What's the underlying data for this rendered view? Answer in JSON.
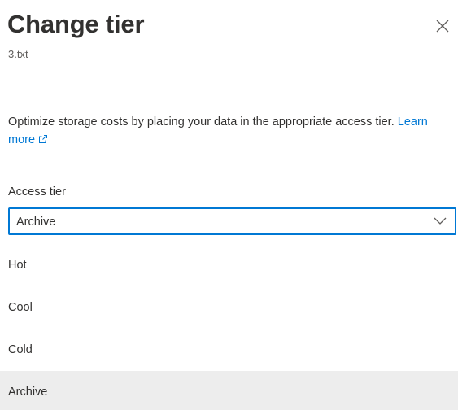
{
  "panel": {
    "title": "Change tier",
    "subtitle": "3.txt",
    "close_icon": "close-icon"
  },
  "description": {
    "text": "Optimize storage costs by placing your data in the appropriate access tier.",
    "link_text": "Learn more",
    "link_icon": "external-link-icon"
  },
  "access_tier": {
    "label": "Access tier",
    "selected": "Archive",
    "chevron_icon": "chevron-down-icon",
    "options": [
      "Hot",
      "Cool",
      "Cold",
      "Archive"
    ]
  },
  "colors": {
    "accent": "#0078d4",
    "selected_option_bg": "#ededed"
  }
}
